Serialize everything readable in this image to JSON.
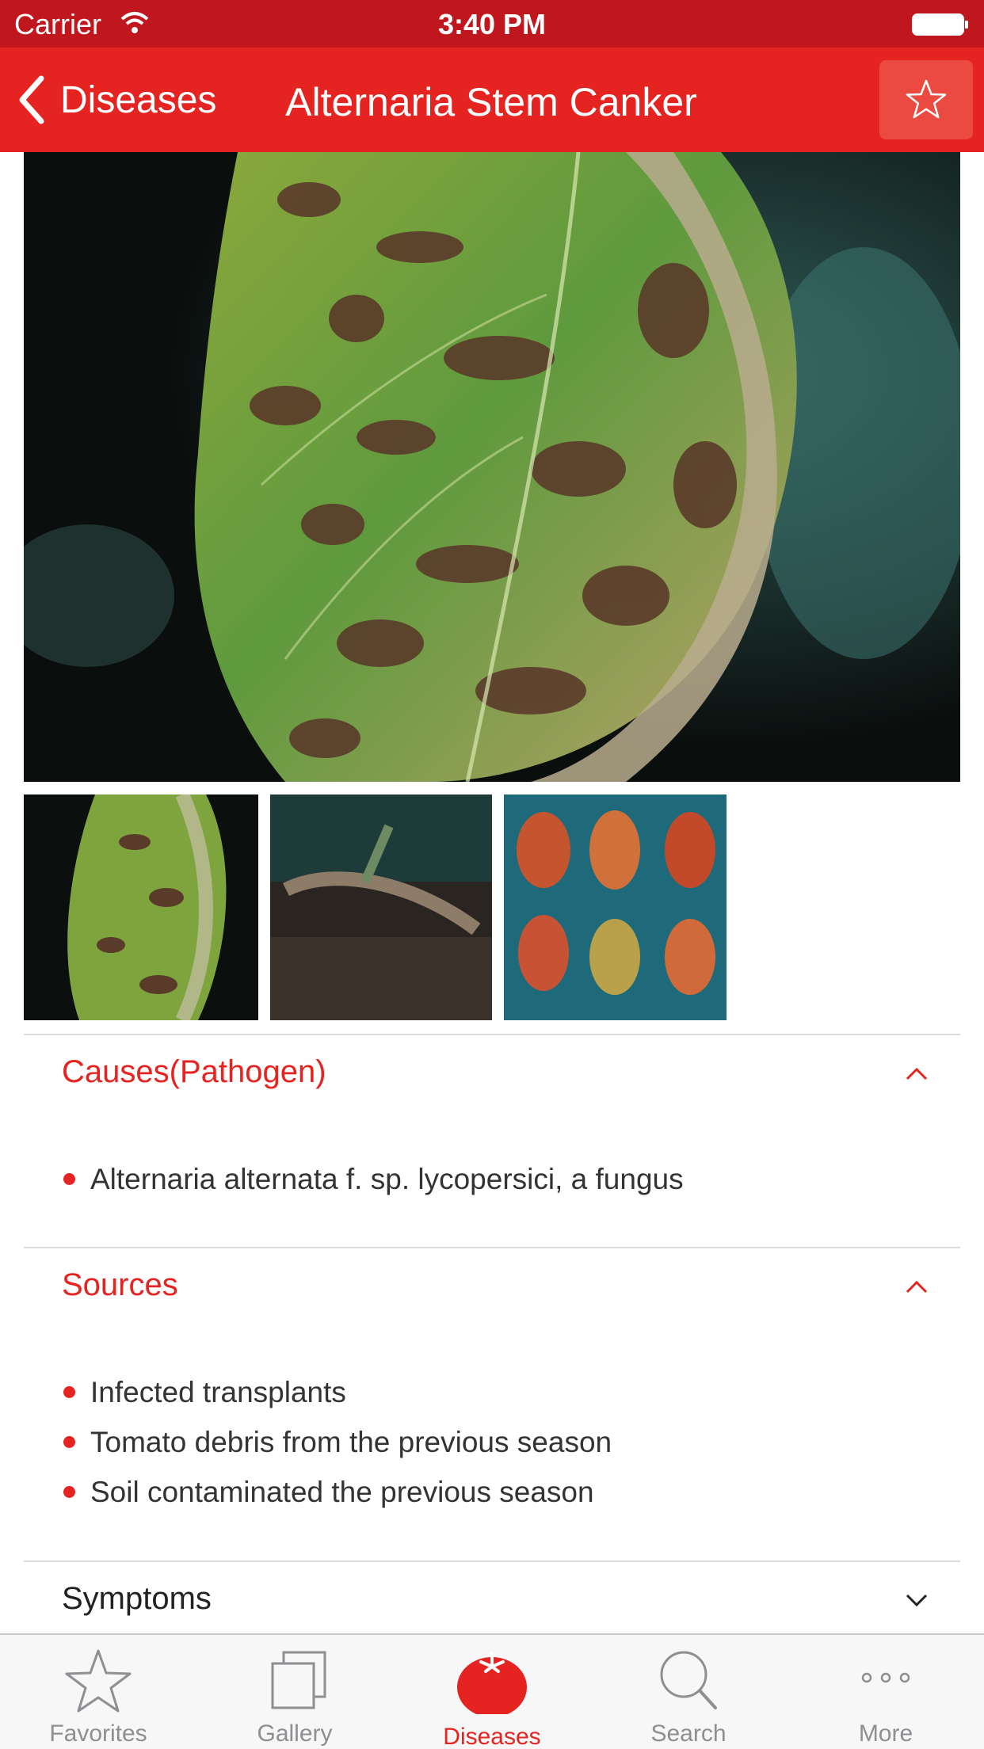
{
  "status_bar": {
    "carrier": "Carrier",
    "time": "3:40 PM"
  },
  "nav": {
    "back_label": "Diseases",
    "title": "Alternaria Stem Canker"
  },
  "sections": {
    "causes": {
      "title": "Causes(Pathogen)",
      "items": [
        "Alternaria alternata f. sp. lycopersici, a fungus"
      ]
    },
    "sources": {
      "title": "Sources",
      "items": [
        "Infected transplants",
        "Tomato debris from the previous season",
        "Soil contaminated the previous season"
      ]
    },
    "symptoms": {
      "title": "Symptoms"
    }
  },
  "tabs": [
    {
      "label": "Favorites",
      "icon": "star-icon"
    },
    {
      "label": "Gallery",
      "icon": "gallery-icon"
    },
    {
      "label": "Diseases",
      "icon": "tomato-icon",
      "active": true
    },
    {
      "label": "Search",
      "icon": "search-icon"
    },
    {
      "label": "More",
      "icon": "more-icon"
    }
  ],
  "colors": {
    "accent": "#e52421",
    "status_bar": "#c0161d",
    "tab_inactive": "#8e8e93"
  }
}
